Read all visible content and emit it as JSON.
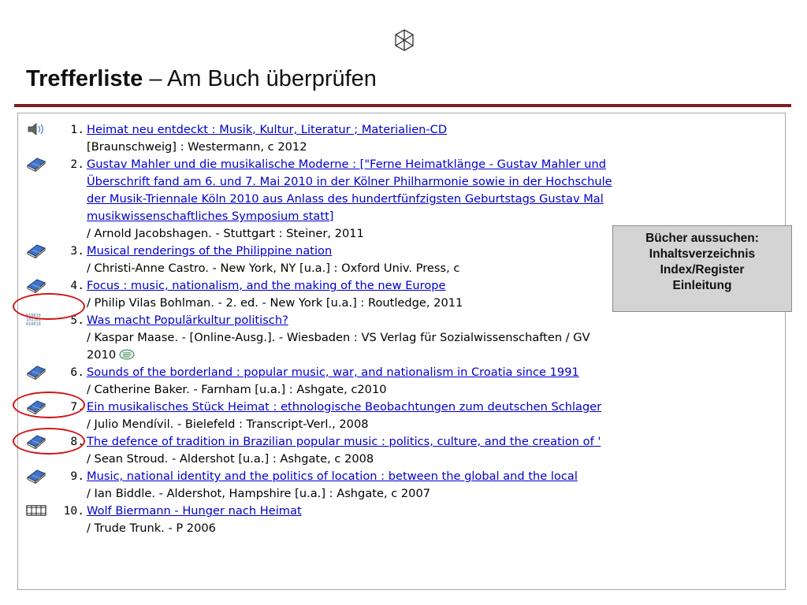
{
  "slide": {
    "title_bold": "Trefferliste",
    "title_rest": " – Am Buch überprüfen",
    "rule_color": "#7b1e1e",
    "logo_icon": "cube-logo-icon"
  },
  "results": [
    {
      "num": "1.",
      "icon": "audio-speaker-icon",
      "title": [
        "Heimat neu entdeckt : Musik, Kultur, Literatur ; Materialien-CD"
      ],
      "details": [
        "[Braunschweig] : Westermann, c 2012"
      ]
    },
    {
      "num": "2.",
      "icon": "book-icon",
      "title": [
        "Gustav Mahler und die musikalische Moderne : [\"Ferne Heimatklänge - Gustav Mahler und",
        "Überschrift fand am 6. und 7. Mai 2010 in der Kölner Philharmonie sowie in der Hochschule",
        "der Musik-Triennale Köln 2010 aus Anlass des hundertfünfzigsten Geburtstags Gustav Mal",
        "musikwissenschaftliches Symposium statt]"
      ],
      "details": [
        "/ Arnold Jacobshagen. - Stuttgart : Steiner, 2011"
      ]
    },
    {
      "num": "3.",
      "icon": "book-icon",
      "title": [
        "Musical renderings of the Philippine nation"
      ],
      "details": [
        "/ Christi-Anne Castro. - New York, NY [u.a.] : Oxford Univ. Press, c"
      ]
    },
    {
      "num": "4.",
      "icon": "book-icon",
      "title": [
        "Focus : music, nationalism, and the making of the new Europe"
      ],
      "details": [
        "/ Philip Vilas Bohlman. - 2. ed. - New York [u.a.] : Routledge, 2011"
      ]
    },
    {
      "num": "5.",
      "icon": "digital-resource-icon",
      "title": [
        "Was macht Populärkultur politisch?"
      ],
      "details": [
        "/ Kaspar Maase. - [Online-Ausg.]. - Wiesbaden : VS Verlag für Sozialwissenschaften / GV",
        "2010"
      ],
      "has_online_icon": true
    },
    {
      "num": "6.",
      "icon": "book-icon",
      "title": [
        "Sounds of the borderland : popular music, war, and nationalism in Croatia since 1991"
      ],
      "details": [
        "/ Catherine Baker. - Farnham [u.a.] : Ashgate, c2010"
      ]
    },
    {
      "num": "7.",
      "icon": "book-icon",
      "title": [
        "Ein musikalisches Stück Heimat : ethnologische Beobachtungen zum deutschen Schlager"
      ],
      "details": [
        "/ Julio Mendívil. - Bielefeld : Transcript-Verl., 2008"
      ]
    },
    {
      "num": "8.",
      "icon": "book-icon",
      "title": [
        "The defence of tradition in Brazilian popular music : politics, culture, and the creation of '"
      ],
      "details": [
        "/ Sean Stroud. - Aldershot [u.a.] : Ashgate, c 2008"
      ]
    },
    {
      "num": "9.",
      "icon": "book-icon",
      "title": [
        "Music, national identity and the politics of location : between the global and the local"
      ],
      "details": [
        "/ Ian Biddle. - Aldershot, Hampshire [u.a.] : Ashgate, c 2007"
      ]
    },
    {
      "num": "10.",
      "icon": "film-icon",
      "title": [
        "Wolf Biermann - Hunger nach Heimat"
      ],
      "details": [
        "/ Trude Trunk. - P 2006"
      ]
    }
  ],
  "callout": {
    "lines": [
      "Bücher aussuchen:",
      "Inhaltsverzeichnis",
      "Index/Register",
      "Einleitung"
    ]
  },
  "highlight_color": "#d21414",
  "link_color": "#0000cc"
}
